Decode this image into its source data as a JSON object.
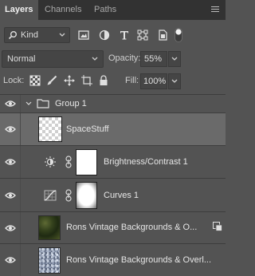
{
  "tabs": [
    {
      "label": "Layers",
      "active": true
    },
    {
      "label": "Channels",
      "active": false
    },
    {
      "label": "Paths",
      "active": false
    }
  ],
  "filter": {
    "kind_label": "Kind",
    "icons": [
      "pixel-filter-icon",
      "adjustment-filter-icon",
      "type-filter-icon",
      "shape-filter-icon",
      "smart-object-filter-icon",
      "filter-toggle-icon"
    ]
  },
  "blend": {
    "mode": "Normal",
    "opacity_label": "Opacity:",
    "opacity_value": "55%"
  },
  "lock": {
    "label": "Lock:",
    "icons": [
      "lock-transparent-icon",
      "lock-image-icon",
      "lock-position-icon",
      "lock-artboard-icon",
      "lock-all-icon"
    ],
    "fill_label": "Fill:",
    "fill_value": "100%"
  },
  "layers": [
    {
      "name": "Group 1",
      "type": "group",
      "visible": true,
      "expanded": true
    },
    {
      "name": "SpaceStuff",
      "type": "pixel",
      "visible": true,
      "selected": true
    },
    {
      "name": "Brightness/Contrast 1",
      "type": "adjustment",
      "adjustment_icon": "brightness-contrast-icon",
      "visible": true
    },
    {
      "name": "Curves 1",
      "type": "adjustment",
      "adjustment_icon": "curves-icon",
      "visible": true
    },
    {
      "name": "Rons Vintage Backgrounds & O...",
      "type": "smart-object",
      "visible": true
    },
    {
      "name": "Rons Vintage Backgrounds & Overl...",
      "type": "pixel",
      "visible": true
    }
  ],
  "colors": {
    "panel_bg": "#535353",
    "tabbar_bg": "#323232",
    "selected_row": "#6a6a6a"
  }
}
